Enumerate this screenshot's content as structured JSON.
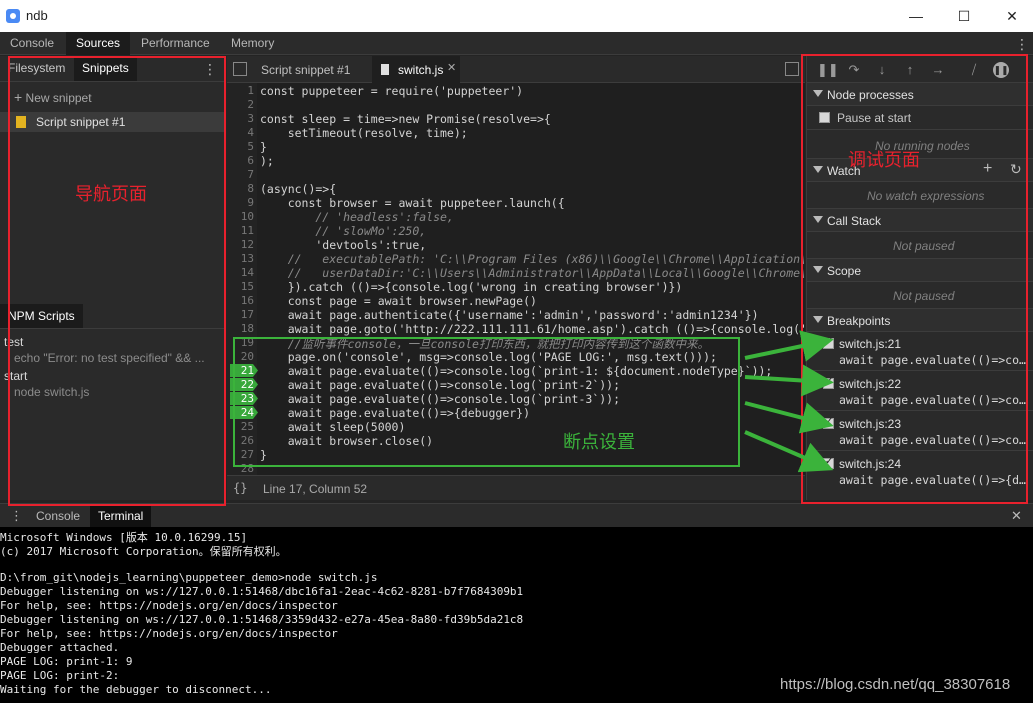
{
  "window": {
    "title": "ndb",
    "minimize": "—",
    "maximize": "☐",
    "close": "✕"
  },
  "main_tabs": [
    "Console",
    "Sources",
    "Performance",
    "Memory"
  ],
  "navigator": {
    "tabs": [
      "Filesystem",
      "Snippets"
    ],
    "new_snippet": "New snippet",
    "snippet": "Script snippet #1",
    "npm_tab": "NPM Scripts",
    "scripts": [
      {
        "name": "test",
        "cmd": "echo \"Error: no test specified\" && ..."
      },
      {
        "name": "start",
        "cmd": "node switch.js"
      }
    ]
  },
  "editor": {
    "tabs": [
      "Script snippet #1",
      "switch.js"
    ],
    "active_tab": "switch.js",
    "status": "Line 17, Column 52",
    "breakpoint_lines": [
      21,
      22,
      23,
      24
    ],
    "lines": [
      "const puppeteer = require('puppeteer')",
      "",
      "const sleep = time=>new Promise(resolve=>{",
      "    setTimeout(resolve, time);",
      "}",
      ");",
      "",
      "(async()=>{",
      "    const browser = await puppeteer.launch({",
      "        // 'headless':false,",
      "        // 'slowMo':250,",
      "        'devtools':true,",
      "    //   executablePath: 'C:\\\\Program Files (x86)\\\\Google\\\\Chrome\\\\Application\\\\c",
      "    //   userDataDir:'C:\\\\Users\\\\Administrator\\\\AppData\\\\Local\\\\Google\\\\Chrome\\\\Use",
      "    }).catch (()=>{console.log('wrong in creating browser')})",
      "    const page = await browser.newPage()",
      "    await page.authenticate({'username':'admin','password':'admin1234'})",
      "    await page.goto('http://222.111.111.61/home.asp').catch (()=>{console.log('wron",
      "    //监听事件console，一旦console打印东西，就把打印内容传到这个函数中来。",
      "    page.on('console', msg=>console.log('PAGE LOG:', msg.text()));",
      "    await page.evaluate(()=>console.log(`print-1: ${document.nodeType}`));",
      "    await page.evaluate(()=>console.log(`print-2`));",
      "    await page.evaluate(()=>console.log(`print-3`));",
      "    await page.evaluate(()=>{debugger})",
      "    await sleep(5000)",
      "    await browser.close()",
      "}",
      ""
    ]
  },
  "debugger": {
    "node_processes": "Node processes",
    "pause_at_start": "Pause at start",
    "no_nodes": "No running nodes",
    "watch": "Watch",
    "no_watch": "No watch expressions",
    "call_stack": "Call Stack",
    "not_paused_1": "Not paused",
    "scope": "Scope",
    "not_paused_2": "Not paused",
    "breakpoints_title": "Breakpoints",
    "breakpoints": [
      {
        "file": "switch.js:21",
        "code": "await page.evaluate(()=>con..."
      },
      {
        "file": "switch.js:22",
        "code": "await page.evaluate(()=>con..."
      },
      {
        "file": "switch.js:23",
        "code": "await page.evaluate(()=>con..."
      },
      {
        "file": "switch.js:24",
        "code": "await page.evaluate(()=>{de..."
      }
    ]
  },
  "drawer": {
    "tabs": [
      "Console",
      "Terminal"
    ],
    "active": "Terminal"
  },
  "terminal": [
    "Microsoft Windows [版本 10.0.16299.15]",
    "(c) 2017 Microsoft Corporation。保留所有权利。",
    "",
    "D:\\from_git\\nodejs_learning\\puppeteer_demo>node switch.js",
    "Debugger listening on ws://127.0.0.1:51468/dbc16fa1-2eac-4c62-8281-b7f7684309b1",
    "For help, see: https://nodejs.org/en/docs/inspector",
    "Debugger listening on ws://127.0.0.1:51468/3359d432-e27a-45ea-8a80-fd39b5da21c8",
    "For help, see: https://nodejs.org/en/docs/inspector",
    "Debugger attached.",
    "PAGE LOG: print-1: 9",
    "PAGE LOG: print-2:",
    "Waiting for the debugger to disconnect..."
  ],
  "annotations": {
    "nav_label": "导航页面",
    "debug_label": "调试页面",
    "breakpoint_label": "断点设置",
    "accent_red": "#e8212d",
    "accent_green": "#3bb33b"
  },
  "watermark": "https://blog.csdn.net/qq_38307618"
}
